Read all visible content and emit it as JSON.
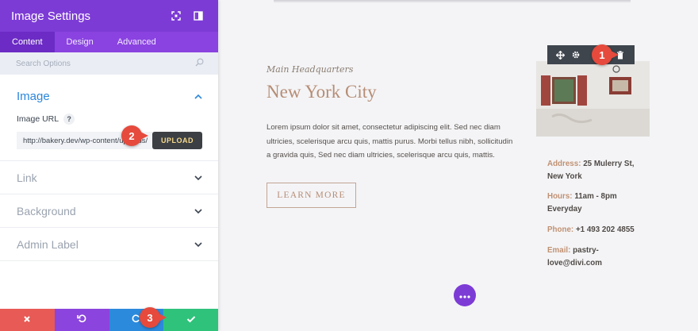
{
  "panel": {
    "title": "Image Settings",
    "tabs": [
      {
        "label": "Content",
        "active": true
      },
      {
        "label": "Design",
        "active": false
      },
      {
        "label": "Advanced",
        "active": false
      }
    ],
    "search_placeholder": "Search Options",
    "image_section": {
      "title": "Image",
      "field_label": "Image URL",
      "help": "?",
      "url_value": "http://bakery.dev/wp-content/uploads/",
      "upload_label": "UPLOAD"
    },
    "sections": [
      "Link",
      "Background",
      "Admin Label"
    ],
    "footer_colors": {
      "discard": "#e85a55",
      "undo": "#8b44dd",
      "redo": "#2c8adc",
      "save": "#2ec27b"
    }
  },
  "page": {
    "kicker": "Main Headquarters",
    "headline": "New York City",
    "body": "Lorem ipsum dolor sit amet, consectetur adipiscing elit. Sed nec diam ultricies, scelerisque arcu quis, mattis purus. Morbi tellus nibh, sollicitudin a gravida quis, Sed nec diam ultricies, scelerisque arcu quis, mattis.",
    "button": "LEARN MORE",
    "contact": [
      {
        "key": "Address:",
        "value": "25 Mulerry St, New York"
      },
      {
        "key": "Hours:",
        "value": "11am - 8pm Everyday"
      },
      {
        "key": "Phone:",
        "value": "+1 493 202 4855"
      },
      {
        "key": "Email:",
        "value": "pastry-love@divi.com"
      }
    ]
  },
  "markers": [
    "1",
    "2",
    "3"
  ],
  "colors": {
    "accent": "#7d3bd6",
    "link_blue": "#2b87da",
    "brand_tan": "#b68d76",
    "marker_red": "#e64a3c"
  }
}
